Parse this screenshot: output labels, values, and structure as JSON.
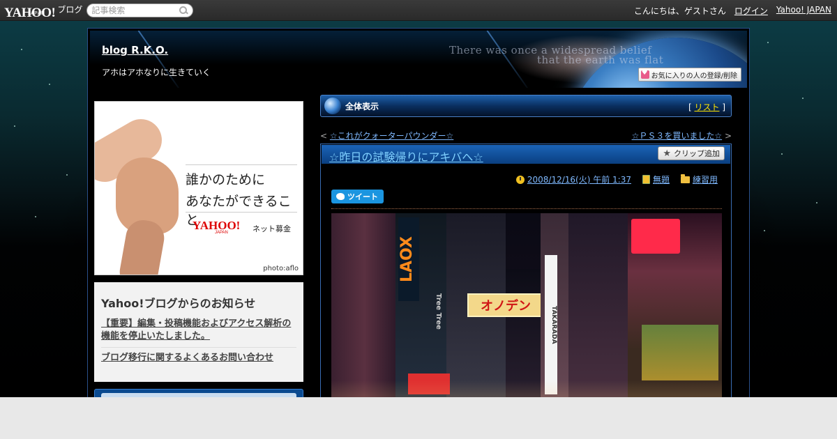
{
  "masthead": {
    "logo_main": "YAHOO!",
    "logo_sub": "JAPAN",
    "logo_product": "ブログ",
    "search_placeholder": "記事検索",
    "greeting": "こんにちは、ゲストさん",
    "login_label": "ログイン",
    "yahoo_japan_label": "Yahoo! JAPAN"
  },
  "blog": {
    "title": "blog R.K.O.",
    "subtitle": "アホはアホなりに生きていく",
    "banner_quote_line1": "There was once a widespread belief",
    "banner_quote_line2": "that the earth was flat",
    "favorite_button": "お気に入りの人の登録/削除"
  },
  "ad": {
    "line1": "誰かのために",
    "line2": "あなたができること",
    "logo_main": "YAHOO!",
    "logo_sub": "JAPAN",
    "product": "ネット募金",
    "credit": "photo:aflo"
  },
  "notice": {
    "heading": "Yahoo!ブログからのお知らせ",
    "links": [
      "【重要】編集・投稿機能およびアクセス解析の機能を停止いたしました。",
      "ブログ移行に関するよくあるお問い合わせ"
    ]
  },
  "section": {
    "title": "全体表示",
    "list_bracket_open": "[",
    "list_label": "リスト",
    "list_bracket_close": "]"
  },
  "pager": {
    "prev_arrow": "<",
    "prev_label": "☆これがクォーターパウンダー☆",
    "next_label": "☆ＰＳ３を買いました☆",
    "next_arrow": ">"
  },
  "article": {
    "title": "☆昨日の試験帰りにアキバへ☆",
    "clip_label": "クリップ追加",
    "datetime": "2008/12/16(火) 午前 1:37",
    "theme": "無題",
    "category": "練習用",
    "tweet_label": "ツイート"
  },
  "photo_signs": {
    "laox": "LAOX",
    "onoden": "オノデン",
    "takarada": "TAKARADA",
    "tree": "Tree Tree"
  },
  "colors": {
    "link_blue": "#7fb9ff",
    "list_link_yellow": "#ffe600",
    "header_blue": "#1b64b8",
    "tweet_blue": "#1b95e0"
  }
}
